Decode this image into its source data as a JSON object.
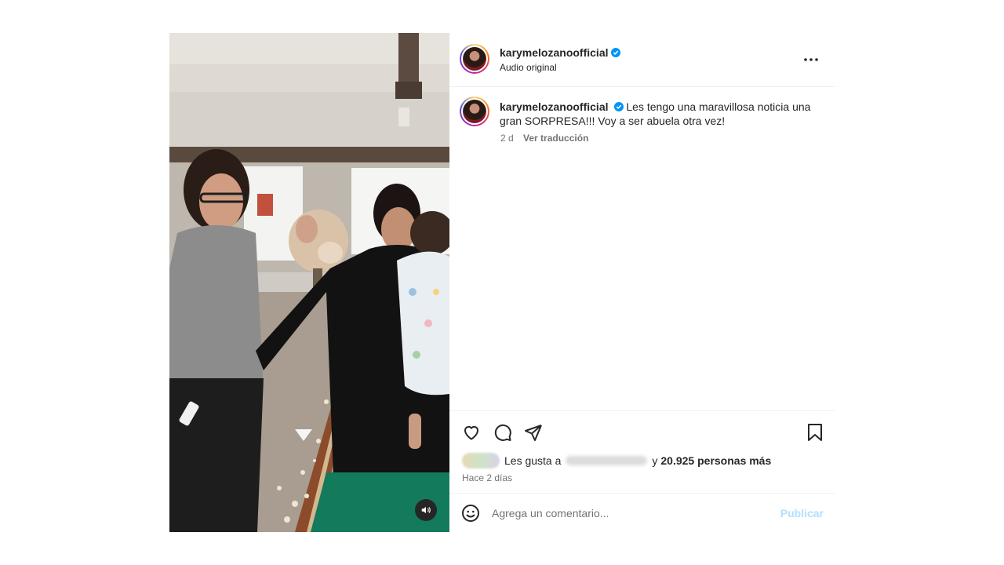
{
  "post": {
    "username": "karymelozanoofficial",
    "audio": "Audio original",
    "caption": "Les tengo una maravillosa noticia una gran SORPRESA!!! Voy a ser abuela otra vez!",
    "age_short": "2 d",
    "translate_label": "Ver traducción",
    "likes_prefix": "Les gusta a",
    "likes_suffix": "y",
    "likes_count": "20.925 personas más",
    "time_ago": "Hace 2 días",
    "comment_placeholder": "Agrega un comentario...",
    "publish_label": "Publicar"
  },
  "icons": {
    "verified": "verified-badge-icon",
    "more": "more-options-icon",
    "like": "heart-icon",
    "comment": "comment-bubble-icon",
    "share": "paper-plane-icon",
    "save": "bookmark-icon",
    "emoji": "emoji-smiley-icon",
    "mute": "speaker-icon"
  },
  "colors": {
    "verified_blue": "#0095f6",
    "publish_disabled": "#b2dffc",
    "secondary_text": "#737373"
  }
}
